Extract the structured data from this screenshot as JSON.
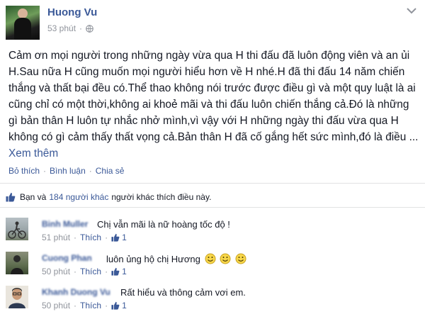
{
  "post": {
    "author": "Huong Vu",
    "time": "53 phút",
    "dot": "·",
    "body_text": "Cảm ơn mọi người trong những ngày vừa qua H thi đấu đã luôn động viên và an ủi H.Sau nữa H cũng muốn mọi người hiểu hơn về H nhé.H đã thi đấu 14 năm chiến thắng và thất bại đều có.Thể thao không nói trước được điều gì và một quy luật là ai cũng chỉ có một thời,không ai khoẻ mãi và thi đấu luôn chiến thắng cả.Đó là những gì bản thân H luôn tự nhắc nhở mình,vì vậy với H những ngày thi đấu vừa qua H không có gì cảm thấy thất vọng cả.Bản thân H đã cố gắng hết sức mình,đó là điều ...",
    "see_more": "Xem thêm",
    "actions": {
      "like": "Bỏ thích",
      "comment": "Bình luận",
      "share": "Chia sẻ",
      "sep": "·"
    }
  },
  "likes": {
    "prefix": "Bạn và",
    "count": "184 người khác",
    "suffix": "người khác thích điều này."
  },
  "comments": [
    {
      "name": "Binh Muller",
      "text": "Chị vẫn mãi là nữ hoàng tốc độ !",
      "time": "51 phút",
      "like_label": "Thích",
      "likes": "1",
      "sep": "·"
    },
    {
      "name": "Cuong Phan",
      "text": "luôn ủng hộ chị Hương",
      "time": "50 phút",
      "like_label": "Thích",
      "likes": "1",
      "sep": "·"
    },
    {
      "name": "Khanh Duong Vu",
      "text": "Rất hiểu và thông cảm vơi em.",
      "time": "50 phút",
      "like_label": "Thích",
      "likes": "1",
      "sep": "·"
    }
  ],
  "icons": {
    "globe": "globe-icon",
    "chevron": "chevron-down-icon",
    "like": "thumbs-up-icon",
    "emoji": "smiley-face-icon"
  },
  "colors": {
    "link": "#3b5998",
    "meta": "#90949c",
    "text": "#141823"
  }
}
